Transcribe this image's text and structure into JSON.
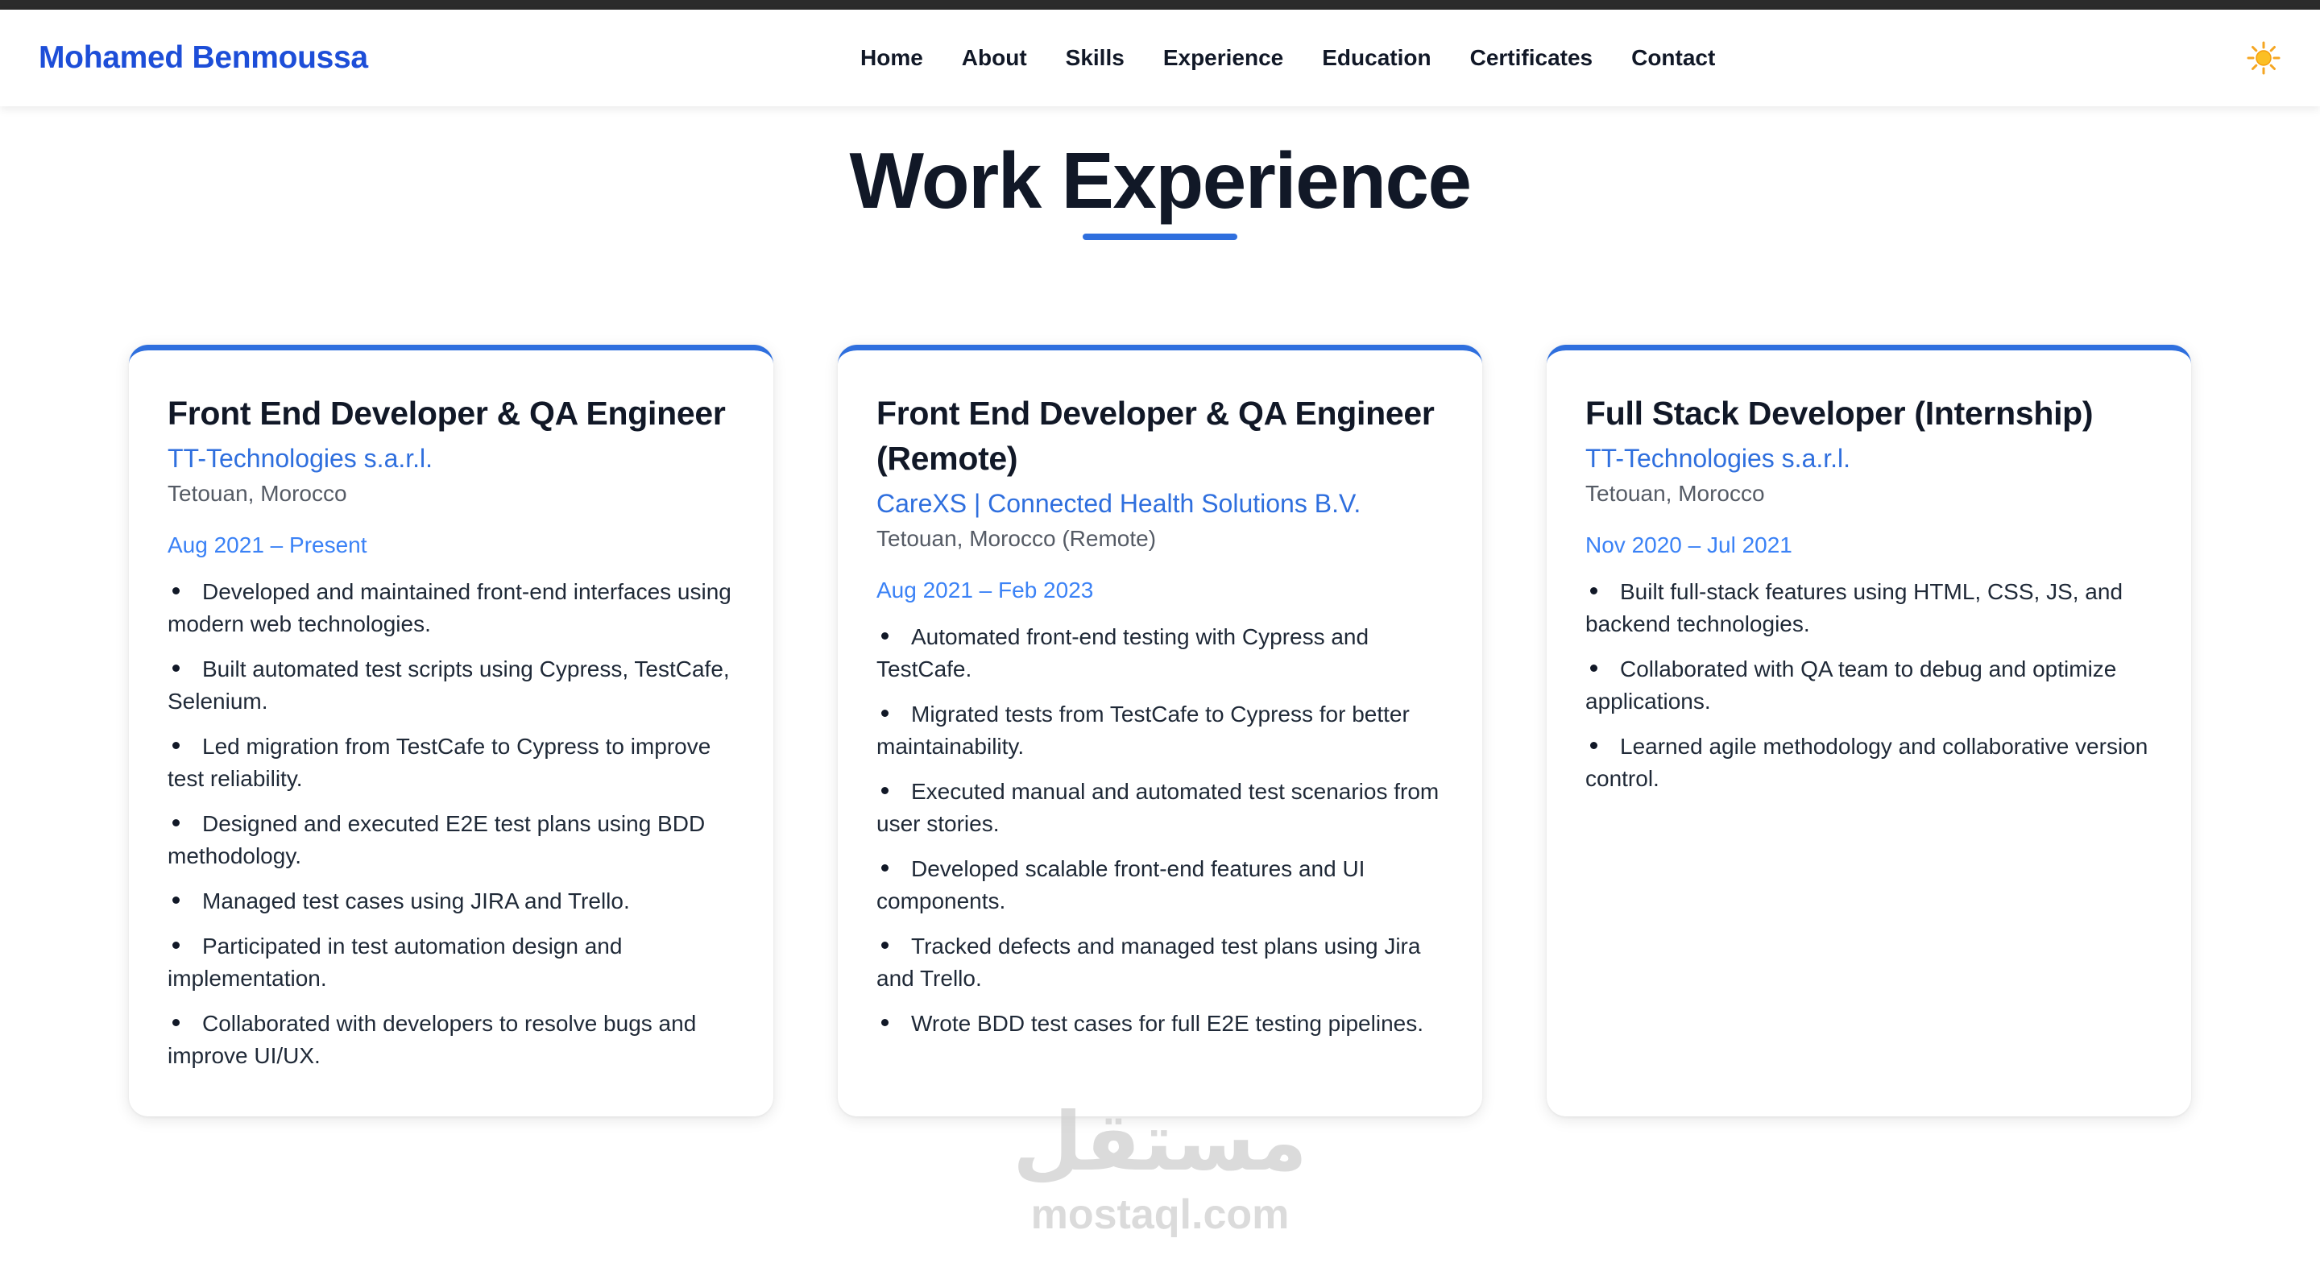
{
  "header": {
    "brand": "Mohamed Benmoussa",
    "nav": [
      "Home",
      "About",
      "Skills",
      "Experience",
      "Education",
      "Certificates",
      "Contact"
    ],
    "theme_icon": "sun-icon"
  },
  "section": {
    "title": "Work Experience"
  },
  "colors": {
    "accent": "#2f6fde",
    "brand": "#1d4ed8",
    "date": "#3b82f6",
    "heading": "#111827"
  },
  "experiences": [
    {
      "title": "Front End Developer & QA Engineer",
      "company": "TT-Technologies s.a.r.l.",
      "location": "Tetouan, Morocco",
      "dates": "Aug 2021 – Present",
      "bullets": [
        "Developed and maintained front-end interfaces using modern web technologies.",
        "Built automated test scripts using Cypress, TestCafe, Selenium.",
        "Led migration from TestCafe to Cypress to improve test reliability.",
        "Designed and executed E2E test plans using BDD methodology.",
        "Managed test cases using JIRA and Trello.",
        "Participated in test automation design and implementation.",
        "Collaborated with developers to resolve bugs and improve UI/UX."
      ]
    },
    {
      "title": "Front End Developer & QA Engineer (Remote)",
      "company": "CareXS | Connected Health Solutions B.V.",
      "location": "Tetouan, Morocco (Remote)",
      "dates": "Aug 2021 – Feb 2023",
      "bullets": [
        "Automated front-end testing with Cypress and TestCafe.",
        "Migrated tests from TestCafe to Cypress for better maintainability.",
        "Executed manual and automated test scenarios from user stories.",
        "Developed scalable front-end features and UI components.",
        "Tracked defects and managed test plans using Jira and Trello.",
        "Wrote BDD test cases for full E2E testing pipelines."
      ]
    },
    {
      "title": "Full Stack Developer (Internship)",
      "company": "TT-Technologies s.a.r.l.",
      "location": "Tetouan, Morocco",
      "dates": "Nov 2020 – Jul 2021",
      "bullets": [
        "Built full-stack features using HTML, CSS, JS, and backend technologies.",
        "Collaborated with QA team to debug and optimize applications.",
        "Learned agile methodology and collaborative version control."
      ]
    }
  ],
  "watermark": {
    "arabic": "مستقل",
    "latin": "mostaql.com"
  }
}
